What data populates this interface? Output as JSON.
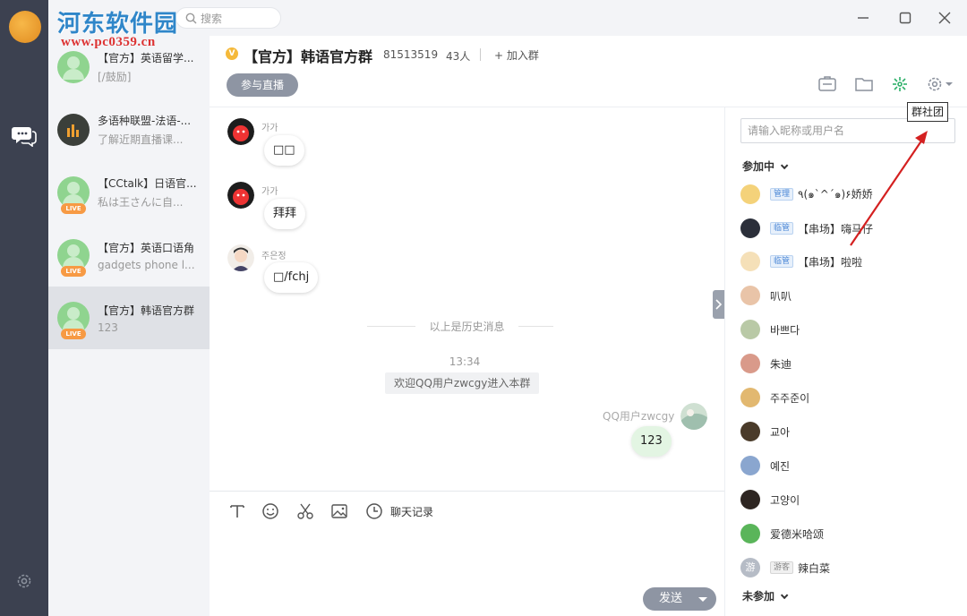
{
  "watermark": {
    "title": "河东软件园",
    "url": "www.pc0359.cn"
  },
  "search": {
    "placeholder": "搜索"
  },
  "conversations": [
    {
      "name": "【官方】英语留学...",
      "preview": "[/鼓励]",
      "live": false
    },
    {
      "name": "多语种联盟-法语-...",
      "preview": "了解近期直播课...",
      "live": false
    },
    {
      "name": "【CCtalk】日语官...",
      "preview": "私は王さんに自...",
      "live": true,
      "badge": "LIVE"
    },
    {
      "name": "【官方】英语口语角",
      "preview": "gadgets phone l...",
      "live": true,
      "badge": "LIVE"
    },
    {
      "name": "【官方】韩语官方群",
      "preview": "123",
      "live": true,
      "badge": "LIVE"
    }
  ],
  "header": {
    "verified_badge": "V",
    "title": "【官方】韩语官方群",
    "group_id": "81513519",
    "member_count": "43人",
    "join_label": "+ 加入群",
    "live_button": "参与直播"
  },
  "tooltip": "群社团",
  "messages": [
    {
      "sender": "가가",
      "text": "□□",
      "mine": false
    },
    {
      "sender": "가가",
      "text": "拜拜",
      "mine": false
    },
    {
      "sender": "주은정",
      "text": "□/fchj",
      "mine": false
    },
    {
      "sender": "QQ用户zwcgy",
      "text": "123",
      "mine": true
    }
  ],
  "history_divider": "以上是历史消息",
  "timestamp": "13:34",
  "system_message": "欢迎QQ用户zwcgy进入本群",
  "toolbar": {
    "history_label": "聊天记录",
    "send_label": "发送"
  },
  "members_panel": {
    "search_placeholder": "请输入昵称或用户名",
    "joined_label": "参加中",
    "not_joined_label": "未参加",
    "members": [
      {
        "tag": "管理",
        "name": "٩(๑`^´๑)۶娇娇",
        "color": "#f4d27a"
      },
      {
        "tag": "临管",
        "name": "【串场】嗨马仔",
        "color": "#2b2f3a"
      },
      {
        "tag": "临管",
        "name": "【串场】啦啦",
        "color": "#f5e0b8"
      },
      {
        "tag": "",
        "name": "叭叭",
        "color": "#e9c4a8"
      },
      {
        "tag": "",
        "name": "바쁘다",
        "color": "#b9c9a6"
      },
      {
        "tag": "",
        "name": "朱迪",
        "color": "#d99a8a"
      },
      {
        "tag": "",
        "name": "주주준이",
        "color": "#e2b870"
      },
      {
        "tag": "",
        "name": "교아",
        "color": "#4a3b2a"
      },
      {
        "tag": "",
        "name": "예진",
        "color": "#8aa6cf"
      },
      {
        "tag": "",
        "name": "고양이",
        "color": "#2e2622"
      },
      {
        "tag": "",
        "name": "爱德米哈颂",
        "color": "#5ab55a"
      },
      {
        "tag": "游客",
        "name": "辣白菜",
        "color": "#b6bcc6",
        "avatar_text": "游"
      }
    ]
  }
}
